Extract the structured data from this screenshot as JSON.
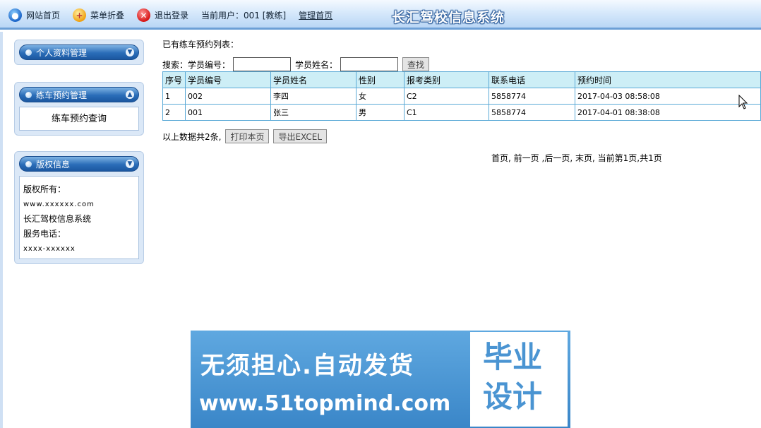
{
  "topbar": {
    "home_label": "网站首页",
    "menu_collapse_label": "菜单折叠",
    "logout_label": "退出登录",
    "current_user": "当前用户：001 [教练]",
    "admin_home_label": "管理首页",
    "system_title": "长汇驾校信息系统"
  },
  "sidebar": {
    "panels": [
      {
        "title": "个人资料管理"
      },
      {
        "title": "练车预约管理",
        "items": [
          "练车预约查询"
        ]
      },
      {
        "title": "版权信息",
        "lines": [
          "版权所有：",
          "www.xxxxxx.com",
          "长汇驾校信息系统",
          "服务电话：",
          "xxxx-xxxxxx"
        ]
      }
    ]
  },
  "main": {
    "list_title": "已有练车预约列表：",
    "search": {
      "label": "搜索：",
      "student_no_label": "学员编号：",
      "student_no_value": "",
      "student_name_label": "学员姓名：",
      "student_name_value": "",
      "search_button": "查找"
    },
    "table": {
      "headers": [
        "序号",
        "学员编号",
        "学员姓名",
        "性别",
        "报考类别",
        "联系电话",
        "预约时间"
      ],
      "rows": [
        [
          "1",
          "002",
          "李四",
          "女",
          "C2",
          "5858774",
          "2017-04-03 08:58:08"
        ],
        [
          "2",
          "001",
          "张三",
          "男",
          "C1",
          "5858774",
          "2017-04-01 08:38:08"
        ]
      ]
    },
    "summary": "以上数据共2条,",
    "print_button": "打印本页",
    "export_button": "导出EXCEL",
    "pager": {
      "first": "首页,",
      "prev": "前一页",
      "next": ",后一页,",
      "last": "末页,",
      "status": "当前第1页,共1页"
    }
  },
  "watermark": {
    "line1": "无须担心.自动发货",
    "line2": "www.51topmind.com",
    "box_line1": "毕业",
    "box_line2": "设计"
  }
}
